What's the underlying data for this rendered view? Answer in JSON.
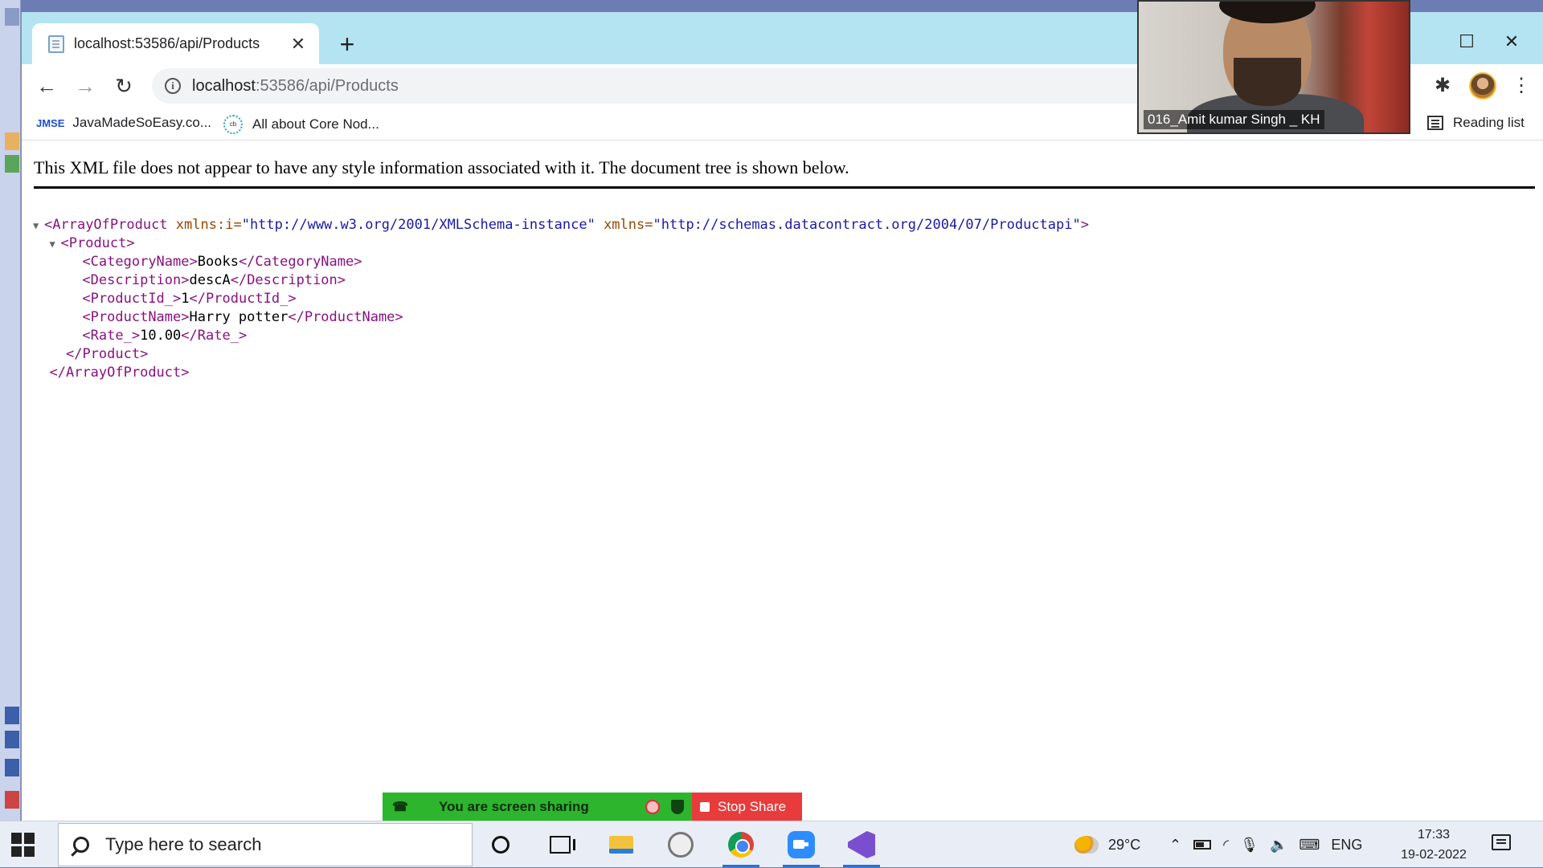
{
  "browser": {
    "tab_title": "localhost:53586/api/Products",
    "url_host": "localhost",
    "url_rest": ":53586/api/Products",
    "bookmarks": [
      {
        "icon_text": "JMSE",
        "label": "JavaMadeSoEasy.co..."
      },
      {
        "icon_text": "cb",
        "label": "All about Core Nod..."
      }
    ],
    "reading_list_label": "Reading list"
  },
  "page": {
    "notice": "This XML file does not appear to have any style information associated with it. The document tree is shown below.",
    "root_tag": "ArrayOfProduct",
    "root_attrs": [
      {
        "name": "xmlns:i",
        "value": "\"http://www.w3.org/2001/XMLSchema-instance\""
      },
      {
        "name": "xmlns",
        "value": "\"http://schemas.datacontract.org/2004/07/Productapi\""
      }
    ],
    "product_tag": "Product",
    "fields": [
      {
        "tag": "CategoryName",
        "value": "Books"
      },
      {
        "tag": "Description",
        "value": "descA"
      },
      {
        "tag": "ProductId_",
        "value": "1"
      },
      {
        "tag": "ProductName",
        "value": "Harry potter"
      },
      {
        "tag": "Rate_",
        "value": "10.00"
      }
    ]
  },
  "webcam": {
    "participant_name": "016_Amit kumar Singh _ KH"
  },
  "share_bar": {
    "status_label": "You are screen sharing",
    "stop_label": "Stop Share"
  },
  "taskbar": {
    "search_placeholder": "Type here to search",
    "temperature": "29°C",
    "language": "ENG",
    "time": "17:33",
    "date": "19-02-2022"
  }
}
